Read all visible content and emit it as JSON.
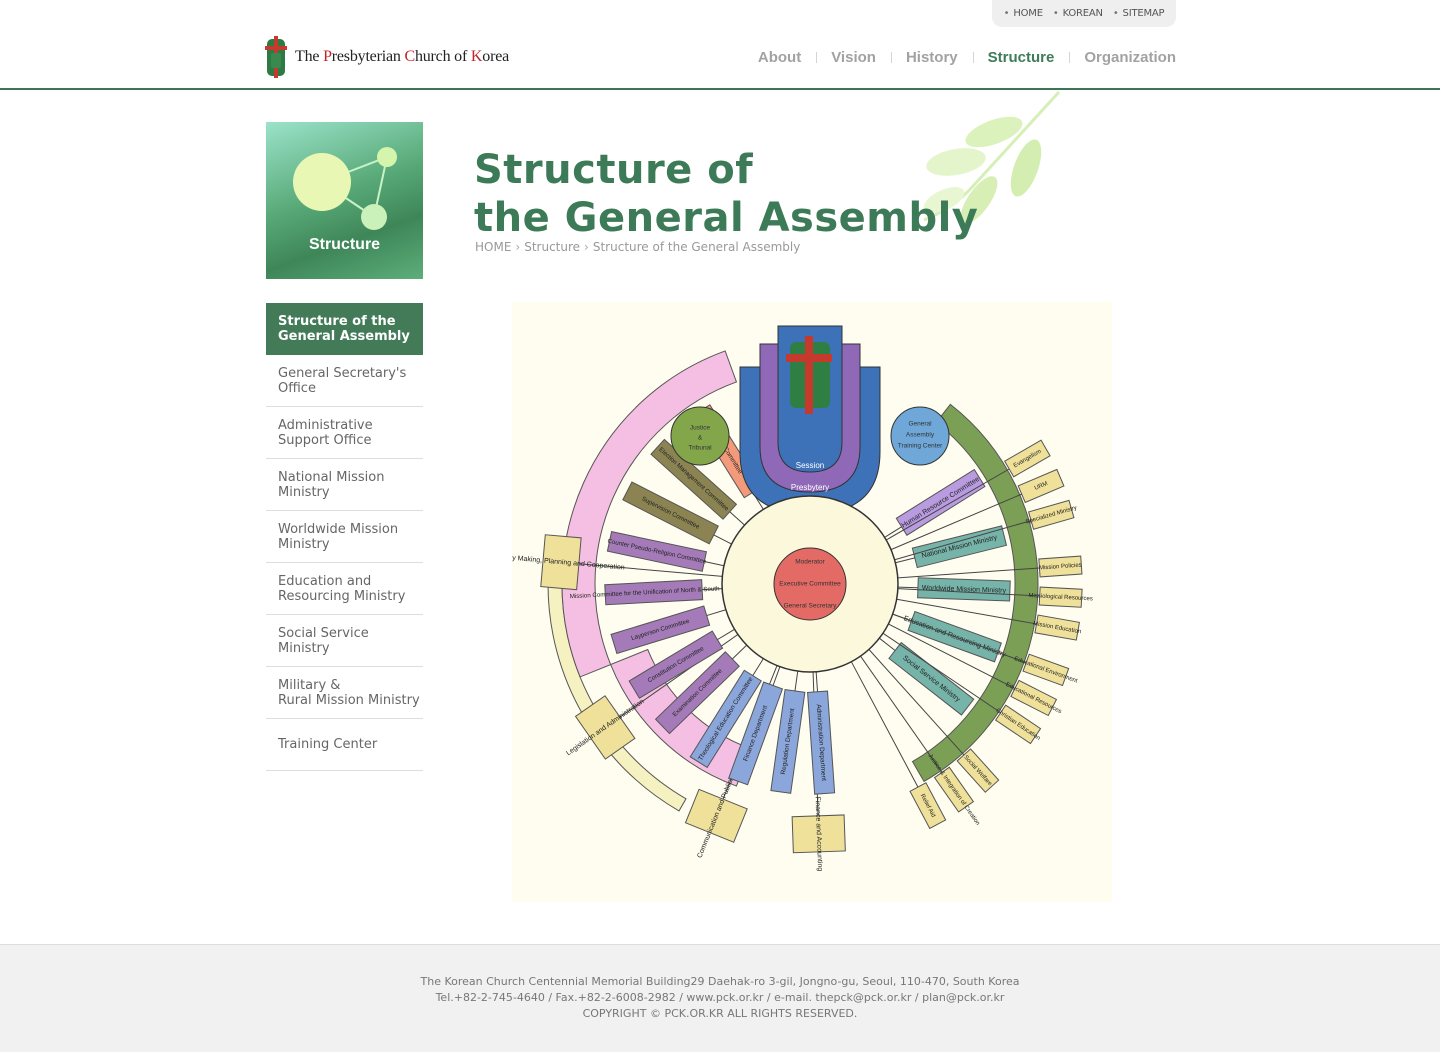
{
  "util_nav": [
    "HOME",
    "KOREAN",
    "SITEMAP"
  ],
  "logo": {
    "pre": "The ",
    "p": "P",
    "mid1": "resbyterian ",
    "c": "C",
    "mid2": "hurch of ",
    "k": "K",
    "post": "orea"
  },
  "gnb": [
    {
      "label": "About",
      "active": false
    },
    {
      "label": "Vision",
      "active": false
    },
    {
      "label": "History",
      "active": false
    },
    {
      "label": "Structure",
      "active": true
    },
    {
      "label": "Organization",
      "active": false
    }
  ],
  "side_title": "Structure",
  "lnb": [
    {
      "label": "Structure of the\nGeneral Assembly",
      "active": true
    },
    {
      "label": "General Secretary's\nOffice",
      "active": false
    },
    {
      "label": "Administrative\nSupport Office",
      "active": false
    },
    {
      "label": "National Mission\nMinistry",
      "active": false
    },
    {
      "label": "Worldwide Mission\nMinistry",
      "active": false
    },
    {
      "label": "Education and\nResourcing Ministry",
      "active": false
    },
    {
      "label": "Social Service Ministry",
      "active": false
    },
    {
      "label": "Military &\nRural Mission Ministry",
      "active": false
    },
    {
      "label": "Training Center",
      "active": false
    }
  ],
  "page_title": "Structure of\nthe General Assembly",
  "breadcrumb": [
    "HOME",
    "Structure",
    "Structure of the General Assembly"
  ],
  "diagram": {
    "top_layers": [
      "Session",
      "Presbytery",
      "General Assembly"
    ],
    "center": [
      "Moderator",
      "Executive Committee",
      "General Secretary"
    ],
    "circles": [
      "Justice & Tribunal",
      "General Assembly Training Center"
    ],
    "left_committees": [
      "Special Committee",
      "Election Management Committee",
      "Supervision Committee",
      "Counter Pseudo-Religion Committee",
      "Mission Committee for the Unification of North & South Korea",
      "Layperson Committee",
      "Constitution Committee",
      "Examination Committee"
    ],
    "bottom_departments": [
      "Theological Education Committee",
      "Finance Department",
      "Regulation Department",
      "Administration Department"
    ],
    "outer_left": [
      "Policy Making, Planning and Cooperation",
      "Legislation and Administration",
      "Communication and Publicity",
      "Finance and Accounting"
    ],
    "right_ministries": [
      "Human Resource Committee",
      "National Mission Ministry",
      "Worldwide Mission Ministry",
      "Education and Resourcing Ministry",
      "Social Service Ministry"
    ],
    "right_outer": [
      "Evangelism",
      "URM",
      "Specialized Ministry",
      "Mission Policies",
      "Missiological Resources",
      "Mission Education",
      "Educational Environment",
      "Educational Resources",
      "Christian Education",
      "Social Welfare",
      "Justice & Integration of Creation",
      "Relief Aid"
    ]
  },
  "footer": {
    "address": "The Korean Church Centennial Memorial Building29 Daehak-ro 3-gil, Jongno-gu, Seoul, 110-470, South Korea",
    "contact": "Tel.+82-2-745-4640 / Fax.+82-2-6008-2982 / www.pck.or.kr / e-mail. thepck@pck.or.kr / plan@pck.or.kr",
    "copyright": "COPYRIGHT © PCK.OR.KR   ALL RIGHTS RESERVED."
  },
  "colors": {
    "brand_green": "#3d7a57",
    "header_line": "#3e7456",
    "menu_inactive": "#a2a2a2"
  }
}
